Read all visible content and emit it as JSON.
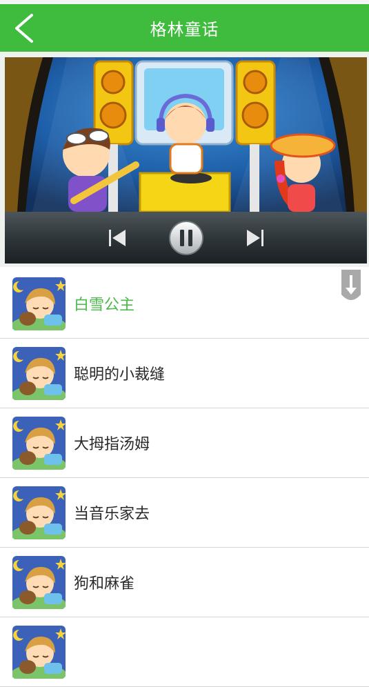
{
  "header": {
    "title": "格林童话",
    "back_icon": "chevron-left-icon"
  },
  "player": {
    "banner_image": "kids-music-stage-illustration",
    "controls": {
      "prev_icon": "skip-previous-icon",
      "pause_icon": "pause-icon",
      "next_icon": "skip-next-icon"
    }
  },
  "stories": [
    {
      "title": "白雪公主",
      "active": true
    },
    {
      "title": "聪明的小裁缝",
      "active": false
    },
    {
      "title": "大拇指汤姆",
      "active": false
    },
    {
      "title": "当音乐家去",
      "active": false
    },
    {
      "title": "狗和麻雀",
      "active": false
    },
    {
      "title": "",
      "active": false
    }
  ],
  "colors": {
    "accent": "#3fbb3e",
    "active_text": "#4cb84a"
  },
  "scroll_icon": "download-arrow-icon"
}
